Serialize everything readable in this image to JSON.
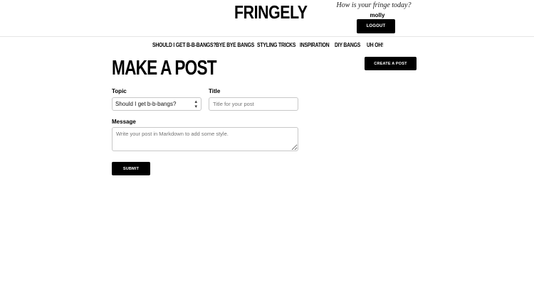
{
  "header": {
    "logo": "FRINGELY",
    "tagline": "How is your fringe today?",
    "username": "molly",
    "logout_label": "LOGOUT"
  },
  "nav": {
    "items": [
      {
        "label": "SHOULD I GET B-B-BANGS?"
      },
      {
        "label": "BYE BYE BANGS"
      },
      {
        "label": "STYLING TRICKS"
      },
      {
        "label": "INSPIRATION"
      },
      {
        "label": "DIY BANGS"
      },
      {
        "label": "UH OH!"
      }
    ]
  },
  "main": {
    "title": "MAKE A POST",
    "create_post_label": "CREATE A POST",
    "form": {
      "topic_label": "Topic",
      "topic_value": "Should I get b-b-bangs?",
      "title_label": "Title",
      "title_placeholder": "Title for your post",
      "message_label": "Message",
      "message_placeholder": "Write your post in Markdown to add some style.",
      "submit_label": "SUBMIT"
    }
  }
}
